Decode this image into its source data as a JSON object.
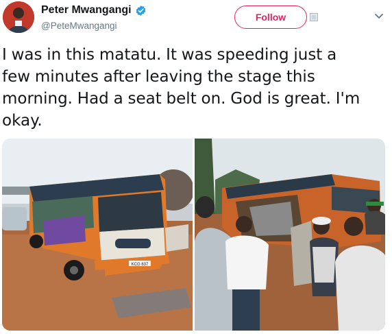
{
  "user": {
    "display_name": "Peter Mwangangi",
    "handle": "@PeteMwangangi",
    "verified": true,
    "avatar_icon": "avatar-photo"
  },
  "actions": {
    "follow_label": "Follow"
  },
  "tweet": {
    "lines": [
      "I was in this matatu. It was speeding just a",
      "few minutes after leaving the stage this",
      "morning. Had a seat belt on. God is great. I'm",
      "okay."
    ]
  },
  "media": {
    "photos": [
      {
        "alt_icon": "crashed-matatu-photo",
        "plate": "KCG 637"
      },
      {
        "alt_icon": "crowd-around-matatu-photo"
      }
    ]
  },
  "colors": {
    "brand_follow": "#e0245e",
    "verified_blue": "#1da1f2",
    "text": "#14171a",
    "muted": "#657786"
  }
}
